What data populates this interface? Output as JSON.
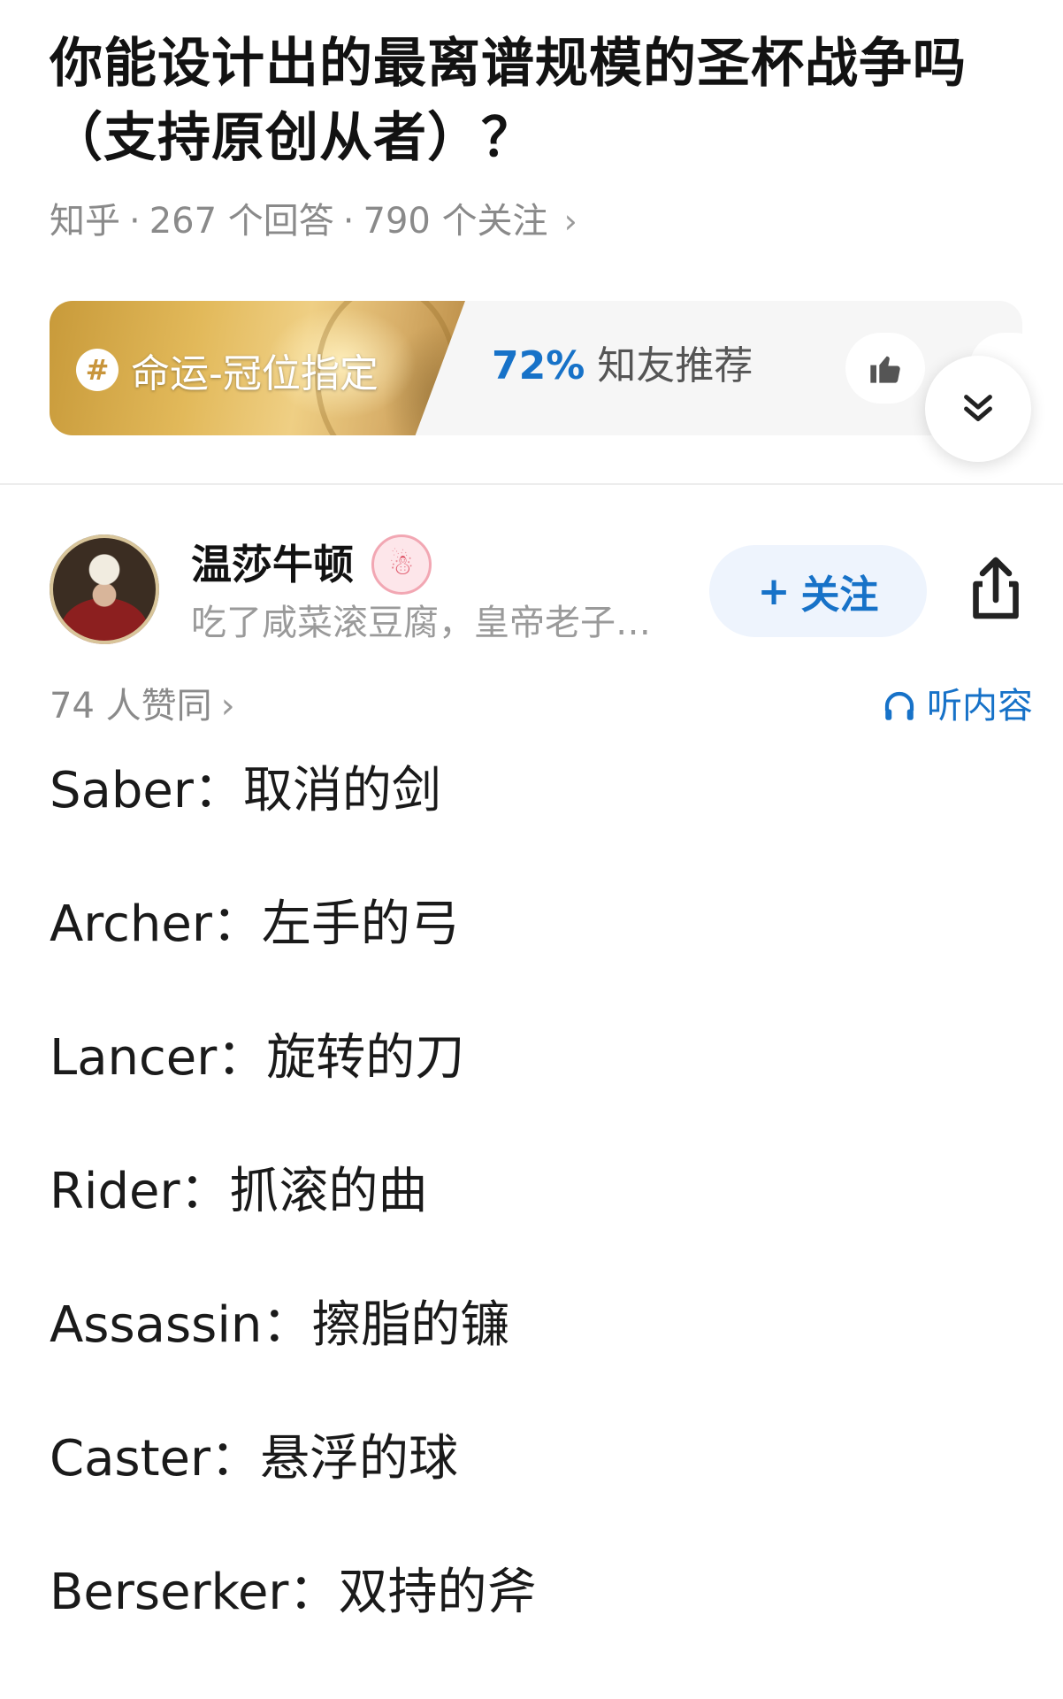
{
  "question": {
    "title": "你能设计出的最离谱规模的圣杯战争吗（支持原创从者）？",
    "source": "知乎",
    "answers": "267 个回答",
    "followers": "790 个关注",
    "separator": "·",
    "chevron": "›"
  },
  "banner": {
    "topic": "命运-冠位指定",
    "topic_icon": "hash-icon",
    "recommend_pct": "72%",
    "recommend_label": "知友推荐",
    "like_icon": "thumbs-up-icon",
    "expand_icon": "double-chevron-down-icon"
  },
  "author": {
    "name": "温莎牛顿",
    "bio": "吃了咸菜滚豆腐，皇帝老子…",
    "badge_icon": "snowman-badge-icon",
    "follow_label": "关注",
    "follow_icon": "plus-icon",
    "share_icon": "share-icon"
  },
  "stats": {
    "agree": "74 人赞同",
    "chevron": "›",
    "listen": "听内容",
    "listen_icon": "headphones-icon"
  },
  "answer_lines": [
    "Saber：取消的剑",
    "Archer：左手的弓",
    "Lancer：旋转的刀",
    "Rider：抓滚的曲",
    "Assassin：擦脂的镰",
    "Caster：悬浮的球",
    "Berserker：双持的斧"
  ],
  "colors": {
    "accent": "#1772c8",
    "muted": "#8a8a8a",
    "title": "#121212"
  }
}
